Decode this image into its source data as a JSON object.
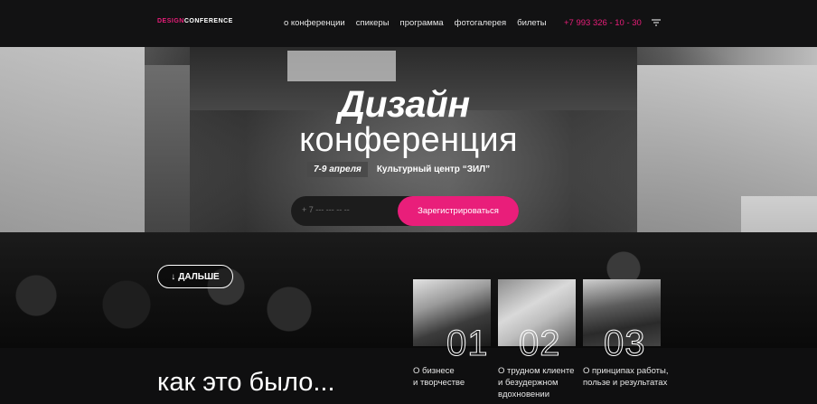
{
  "header": {
    "logo_part1": "DESIGN",
    "logo_part2": "CONFERENCE",
    "nav": [
      "о конференции",
      "спикеры",
      "программа",
      "фотогалерея",
      "билеты"
    ],
    "phone": "+7 993 326 - 10 - 30",
    "menu_icon": "hamburger-icon"
  },
  "hero": {
    "title_line1": "Дизайн",
    "title_line2": "конференция",
    "dates": "7-9 апреля",
    "venue": "Культурный центр “ЗИЛ”",
    "phone_placeholder": "+ 7 --- --- -- --",
    "register_label": "Зарегистрироваться",
    "next_label": "ДАЛЬШЕ",
    "next_icon": "arrow-down-icon"
  },
  "features": [
    {
      "number": "01",
      "caption_line1": "О бизнесе",
      "caption_line2": "и творчестве",
      "caption_line3": ""
    },
    {
      "number": "02",
      "caption_line1": "О трудном клиенте",
      "caption_line2": "и безудержном",
      "caption_line3": "вдохновении"
    },
    {
      "number": "03",
      "caption_line1": "О принципах работы,",
      "caption_line2": "пользе и результатах",
      "caption_line3": ""
    }
  ],
  "section": {
    "title": "как это было..."
  },
  "colors": {
    "accent": "#e91e7a",
    "background": "#0f0f10"
  }
}
